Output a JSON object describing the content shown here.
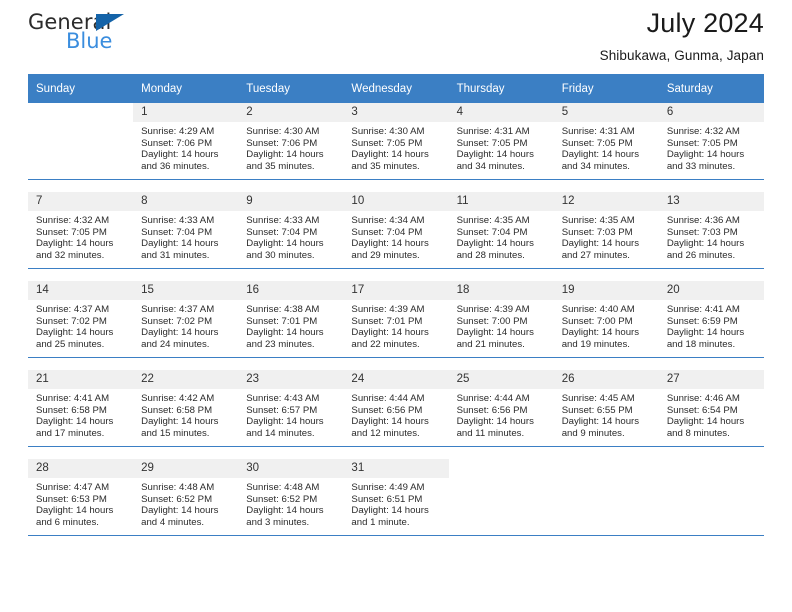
{
  "brand": {
    "name_part1": "General",
    "name_part2": "Blue",
    "triangle_color": "#1463a8",
    "blue_color": "#3a8dde"
  },
  "header": {
    "title": "July 2024",
    "location": "Shibukawa, Gunma, Japan"
  },
  "theme": {
    "header_row_bg": "#3b7fc4",
    "daynum_bg": "#f0f0f0",
    "separator": "#3b7fc4"
  },
  "weekday_headers": [
    "Sunday",
    "Monday",
    "Tuesday",
    "Wednesday",
    "Thursday",
    "Friday",
    "Saturday"
  ],
  "labels": {
    "sunrise_prefix": "Sunrise:",
    "sunset_prefix": "Sunset:",
    "daylight_prefix": "Daylight:"
  },
  "weeks": [
    [
      {
        "day": "",
        "sunrise": "",
        "sunset": "",
        "daylight_line1": "",
        "daylight_line2": ""
      },
      {
        "day": "1",
        "sunrise": "Sunrise: 4:29 AM",
        "sunset": "Sunset: 7:06 PM",
        "daylight_line1": "Daylight: 14 hours",
        "daylight_line2": "and 36 minutes."
      },
      {
        "day": "2",
        "sunrise": "Sunrise: 4:30 AM",
        "sunset": "Sunset: 7:06 PM",
        "daylight_line1": "Daylight: 14 hours",
        "daylight_line2": "and 35 minutes."
      },
      {
        "day": "3",
        "sunrise": "Sunrise: 4:30 AM",
        "sunset": "Sunset: 7:05 PM",
        "daylight_line1": "Daylight: 14 hours",
        "daylight_line2": "and 35 minutes."
      },
      {
        "day": "4",
        "sunrise": "Sunrise: 4:31 AM",
        "sunset": "Sunset: 7:05 PM",
        "daylight_line1": "Daylight: 14 hours",
        "daylight_line2": "and 34 minutes."
      },
      {
        "day": "5",
        "sunrise": "Sunrise: 4:31 AM",
        "sunset": "Sunset: 7:05 PM",
        "daylight_line1": "Daylight: 14 hours",
        "daylight_line2": "and 34 minutes."
      },
      {
        "day": "6",
        "sunrise": "Sunrise: 4:32 AM",
        "sunset": "Sunset: 7:05 PM",
        "daylight_line1": "Daylight: 14 hours",
        "daylight_line2": "and 33 minutes."
      }
    ],
    [
      {
        "day": "7",
        "sunrise": "Sunrise: 4:32 AM",
        "sunset": "Sunset: 7:05 PM",
        "daylight_line1": "Daylight: 14 hours",
        "daylight_line2": "and 32 minutes."
      },
      {
        "day": "8",
        "sunrise": "Sunrise: 4:33 AM",
        "sunset": "Sunset: 7:04 PM",
        "daylight_line1": "Daylight: 14 hours",
        "daylight_line2": "and 31 minutes."
      },
      {
        "day": "9",
        "sunrise": "Sunrise: 4:33 AM",
        "sunset": "Sunset: 7:04 PM",
        "daylight_line1": "Daylight: 14 hours",
        "daylight_line2": "and 30 minutes."
      },
      {
        "day": "10",
        "sunrise": "Sunrise: 4:34 AM",
        "sunset": "Sunset: 7:04 PM",
        "daylight_line1": "Daylight: 14 hours",
        "daylight_line2": "and 29 minutes."
      },
      {
        "day": "11",
        "sunrise": "Sunrise: 4:35 AM",
        "sunset": "Sunset: 7:04 PM",
        "daylight_line1": "Daylight: 14 hours",
        "daylight_line2": "and 28 minutes."
      },
      {
        "day": "12",
        "sunrise": "Sunrise: 4:35 AM",
        "sunset": "Sunset: 7:03 PM",
        "daylight_line1": "Daylight: 14 hours",
        "daylight_line2": "and 27 minutes."
      },
      {
        "day": "13",
        "sunrise": "Sunrise: 4:36 AM",
        "sunset": "Sunset: 7:03 PM",
        "daylight_line1": "Daylight: 14 hours",
        "daylight_line2": "and 26 minutes."
      }
    ],
    [
      {
        "day": "14",
        "sunrise": "Sunrise: 4:37 AM",
        "sunset": "Sunset: 7:02 PM",
        "daylight_line1": "Daylight: 14 hours",
        "daylight_line2": "and 25 minutes."
      },
      {
        "day": "15",
        "sunrise": "Sunrise: 4:37 AM",
        "sunset": "Sunset: 7:02 PM",
        "daylight_line1": "Daylight: 14 hours",
        "daylight_line2": "and 24 minutes."
      },
      {
        "day": "16",
        "sunrise": "Sunrise: 4:38 AM",
        "sunset": "Sunset: 7:01 PM",
        "daylight_line1": "Daylight: 14 hours",
        "daylight_line2": "and 23 minutes."
      },
      {
        "day": "17",
        "sunrise": "Sunrise: 4:39 AM",
        "sunset": "Sunset: 7:01 PM",
        "daylight_line1": "Daylight: 14 hours",
        "daylight_line2": "and 22 minutes."
      },
      {
        "day": "18",
        "sunrise": "Sunrise: 4:39 AM",
        "sunset": "Sunset: 7:00 PM",
        "daylight_line1": "Daylight: 14 hours",
        "daylight_line2": "and 21 minutes."
      },
      {
        "day": "19",
        "sunrise": "Sunrise: 4:40 AM",
        "sunset": "Sunset: 7:00 PM",
        "daylight_line1": "Daylight: 14 hours",
        "daylight_line2": "and 19 minutes."
      },
      {
        "day": "20",
        "sunrise": "Sunrise: 4:41 AM",
        "sunset": "Sunset: 6:59 PM",
        "daylight_line1": "Daylight: 14 hours",
        "daylight_line2": "and 18 minutes."
      }
    ],
    [
      {
        "day": "21",
        "sunrise": "Sunrise: 4:41 AM",
        "sunset": "Sunset: 6:58 PM",
        "daylight_line1": "Daylight: 14 hours",
        "daylight_line2": "and 17 minutes."
      },
      {
        "day": "22",
        "sunrise": "Sunrise: 4:42 AM",
        "sunset": "Sunset: 6:58 PM",
        "daylight_line1": "Daylight: 14 hours",
        "daylight_line2": "and 15 minutes."
      },
      {
        "day": "23",
        "sunrise": "Sunrise: 4:43 AM",
        "sunset": "Sunset: 6:57 PM",
        "daylight_line1": "Daylight: 14 hours",
        "daylight_line2": "and 14 minutes."
      },
      {
        "day": "24",
        "sunrise": "Sunrise: 4:44 AM",
        "sunset": "Sunset: 6:56 PM",
        "daylight_line1": "Daylight: 14 hours",
        "daylight_line2": "and 12 minutes."
      },
      {
        "day": "25",
        "sunrise": "Sunrise: 4:44 AM",
        "sunset": "Sunset: 6:56 PM",
        "daylight_line1": "Daylight: 14 hours",
        "daylight_line2": "and 11 minutes."
      },
      {
        "day": "26",
        "sunrise": "Sunrise: 4:45 AM",
        "sunset": "Sunset: 6:55 PM",
        "daylight_line1": "Daylight: 14 hours",
        "daylight_line2": "and 9 minutes."
      },
      {
        "day": "27",
        "sunrise": "Sunrise: 4:46 AM",
        "sunset": "Sunset: 6:54 PM",
        "daylight_line1": "Daylight: 14 hours",
        "daylight_line2": "and 8 minutes."
      }
    ],
    [
      {
        "day": "28",
        "sunrise": "Sunrise: 4:47 AM",
        "sunset": "Sunset: 6:53 PM",
        "daylight_line1": "Daylight: 14 hours",
        "daylight_line2": "and 6 minutes."
      },
      {
        "day": "29",
        "sunrise": "Sunrise: 4:48 AM",
        "sunset": "Sunset: 6:52 PM",
        "daylight_line1": "Daylight: 14 hours",
        "daylight_line2": "and 4 minutes."
      },
      {
        "day": "30",
        "sunrise": "Sunrise: 4:48 AM",
        "sunset": "Sunset: 6:52 PM",
        "daylight_line1": "Daylight: 14 hours",
        "daylight_line2": "and 3 minutes."
      },
      {
        "day": "31",
        "sunrise": "Sunrise: 4:49 AM",
        "sunset": "Sunset: 6:51 PM",
        "daylight_line1": "Daylight: 14 hours",
        "daylight_line2": "and 1 minute."
      },
      {
        "day": "",
        "sunrise": "",
        "sunset": "",
        "daylight_line1": "",
        "daylight_line2": ""
      },
      {
        "day": "",
        "sunrise": "",
        "sunset": "",
        "daylight_line1": "",
        "daylight_line2": ""
      },
      {
        "day": "",
        "sunrise": "",
        "sunset": "",
        "daylight_line1": "",
        "daylight_line2": ""
      }
    ]
  ]
}
